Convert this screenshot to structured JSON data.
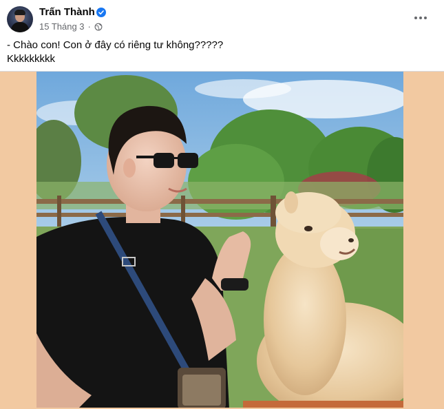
{
  "post": {
    "author": {
      "name": "Trấn Thành",
      "verified": true
    },
    "meta": {
      "date": "15 Tháng 3",
      "audience_icon": "globe-icon"
    },
    "more_icon": "more-horizontal-icon",
    "caption_lines": [
      "- Chào con! Con ở đây có riêng tư không?????",
      "Kkkkkkkkk"
    ]
  },
  "colors": {
    "verified_blue": "#1877f2",
    "meta_gray": "#65676b",
    "photo_frame": "#f2c9a1"
  }
}
